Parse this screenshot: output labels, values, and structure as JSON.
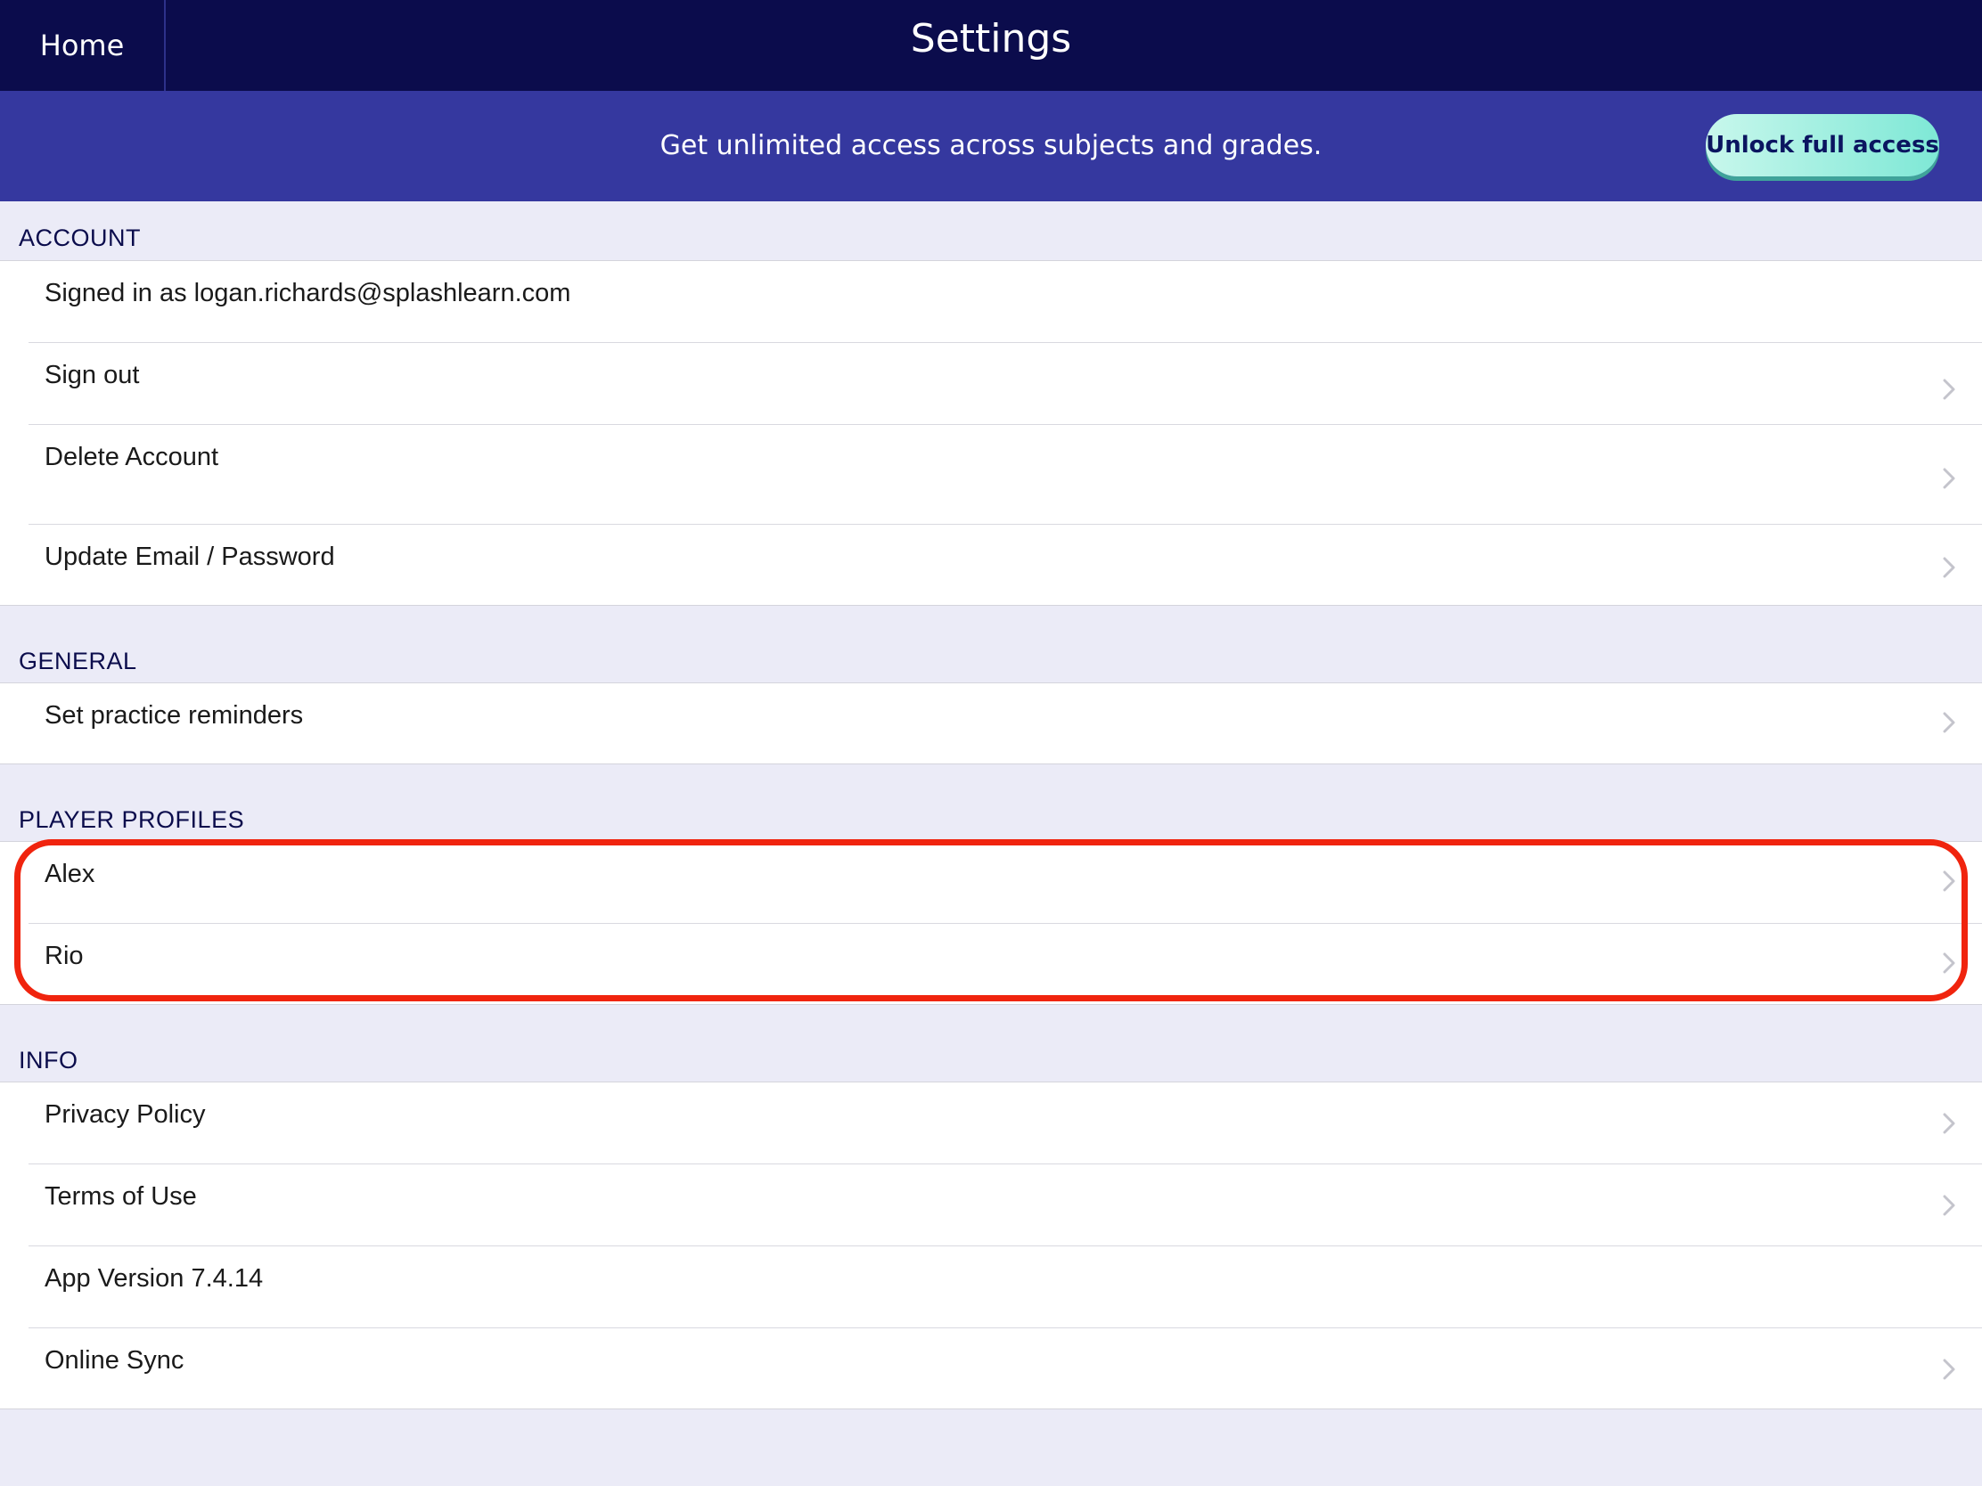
{
  "header": {
    "home_label": "Home",
    "title": "Settings"
  },
  "banner": {
    "text": "Get unlimited access across subjects and grades.",
    "button_label": "Unlock full access"
  },
  "sections": {
    "account": {
      "title": "ACCOUNT",
      "items": [
        {
          "label": "Signed in as logan.richards@splashlearn.com"
        },
        {
          "label": "Sign out"
        },
        {
          "label": "Delete Account"
        },
        {
          "label": "Update Email / Password"
        }
      ]
    },
    "general": {
      "title": "GENERAL",
      "items": [
        {
          "label": "Set practice reminders"
        }
      ]
    },
    "player_profiles": {
      "title": "PLAYER PROFILES",
      "items": [
        {
          "label": "Alex"
        },
        {
          "label": "Rio"
        }
      ]
    },
    "info": {
      "title": "INFO",
      "items": [
        {
          "label": "Privacy Policy"
        },
        {
          "label": "Terms of Use"
        },
        {
          "label": "App Version 7.4.14"
        },
        {
          "label": "Online Sync"
        }
      ]
    }
  },
  "colors": {
    "nav_bg": "#0b0c4c",
    "banner_bg": "#35389f",
    "page_bg": "#ebebf7",
    "highlight": "#f0240e"
  },
  "icons": {
    "chevron": "chevron-right-icon"
  }
}
